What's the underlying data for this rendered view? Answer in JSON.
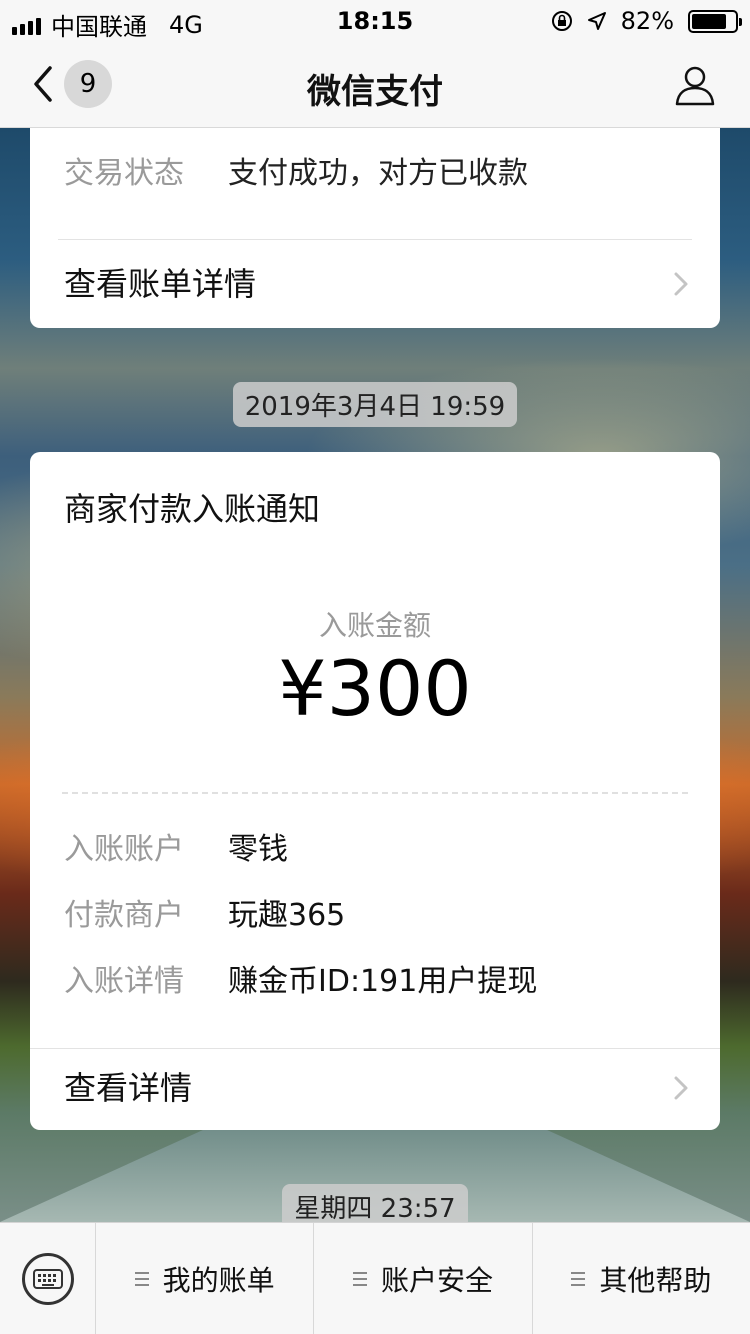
{
  "status_bar": {
    "carrier": "中国联通",
    "network": "4G",
    "time": "18:15",
    "battery": "82%",
    "battery_level": 0.82
  },
  "nav": {
    "badge": "9",
    "title": "微信支付"
  },
  "card1": {
    "status_key": "交易状态",
    "status_value": "支付成功，对方已收款",
    "link": "查看账单详情"
  },
  "timestamp1": "2019年3月4日 19:59",
  "card2": {
    "title": "商家付款入账通知",
    "amount_label": "入账金额",
    "amount": "¥300",
    "rows": [
      {
        "key": "入账账户",
        "value": "零钱"
      },
      {
        "key": "付款商户",
        "value": "玩趣365"
      },
      {
        "key": "入账详情",
        "value": "赚金币ID:191用户提现"
      }
    ],
    "link": "查看详情"
  },
  "timestamp2": "星期四 23:57",
  "tabbar": {
    "items": [
      "我的账单",
      "账户安全",
      "其他帮助"
    ]
  },
  "icons": [
    "keyboard-icon",
    "menu-icon",
    "back-chevron-icon",
    "user-icon",
    "chevron-right-icon",
    "signal-icon",
    "location-icon",
    "lock-rotation-icon",
    "battery-icon"
  ]
}
